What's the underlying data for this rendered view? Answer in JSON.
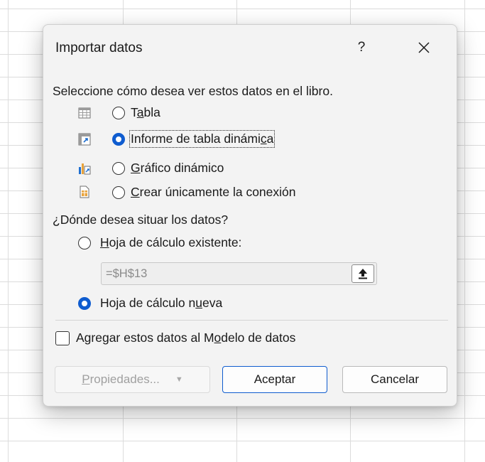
{
  "dialog": {
    "title": "Importar datos",
    "help_label": "?",
    "close_icon": "close-icon"
  },
  "view_section": {
    "heading": "Seleccione cómo desea ver estos datos en el libro.",
    "options": [
      {
        "pre": "T",
        "mnemonic": "a",
        "post": "bla",
        "icon": "table-icon",
        "selected": false
      },
      {
        "pre": "Informe de tabla dinámi",
        "mnemonic": "c",
        "post": "a",
        "icon": "pivot-table-icon",
        "selected": true
      },
      {
        "pre": "",
        "mnemonic": "G",
        "post": "ráfico dinámico",
        "icon": "pivot-chart-icon",
        "selected": false
      },
      {
        "pre": "",
        "mnemonic": "C",
        "post": "rear únicamente la conexión",
        "icon": "connection-only-icon",
        "selected": false
      }
    ]
  },
  "location_section": {
    "heading": "¿Dónde desea situar los datos?",
    "existing": {
      "pre": "",
      "mnemonic": "H",
      "post": "oja de cálculo existente:",
      "selected": false
    },
    "reference_value": "=$H$13",
    "new_sheet": {
      "pre": "Hoja de cálculo n",
      "mnemonic": "u",
      "post": "eva",
      "selected": true
    }
  },
  "data_model": {
    "pre": "Agregar estos datos al M",
    "mnemonic": "o",
    "post": "delo de datos",
    "checked": false
  },
  "buttons": {
    "properties": {
      "pre": "",
      "mnemonic": "P",
      "post": "ropiedades...",
      "enabled": false
    },
    "ok": "Aceptar",
    "cancel": "Cancelar"
  },
  "colors": {
    "accent": "#0f5ccf",
    "dialog_bg": "#f3f3f3",
    "disabled_text": "#a0a0a0"
  }
}
